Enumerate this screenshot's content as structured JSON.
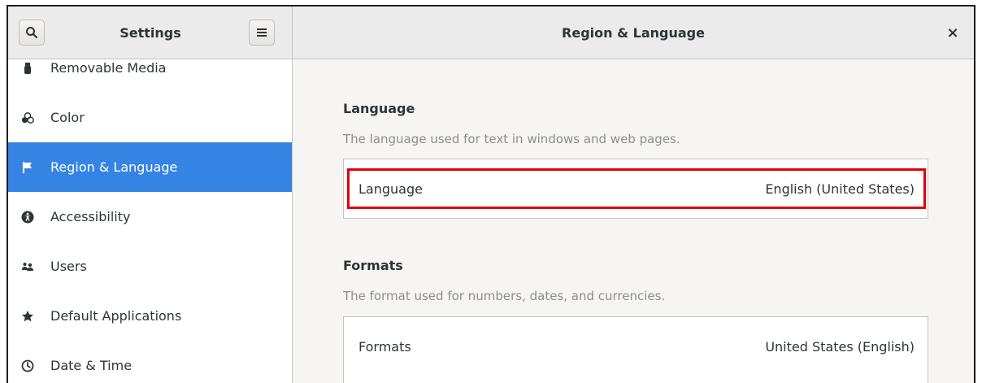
{
  "header": {
    "sidebar_title": "Settings",
    "panel_title": "Region & Language",
    "close_glyph": "×"
  },
  "sidebar": {
    "items": [
      {
        "label": "Removable Media",
        "icon": "usb-drive-icon",
        "selected": false
      },
      {
        "label": "Color",
        "icon": "color-icon",
        "selected": false
      },
      {
        "label": "Region & Language",
        "icon": "flag-icon",
        "selected": true
      },
      {
        "label": "Accessibility",
        "icon": "accessibility-icon",
        "selected": false
      },
      {
        "label": "Users",
        "icon": "users-icon",
        "selected": false
      },
      {
        "label": "Default Applications",
        "icon": "star-icon",
        "selected": false
      },
      {
        "label": "Date & Time",
        "icon": "clock-icon",
        "selected": false
      }
    ]
  },
  "language_section": {
    "title": "Language",
    "description": "The language used for text in windows and web pages.",
    "row_label": "Language",
    "row_value": "English (United States)"
  },
  "formats_section": {
    "title": "Formats",
    "description": "The format used for numbers, dates, and currencies.",
    "row_label": "Formats",
    "row_value": "United States (English)"
  },
  "colors": {
    "accent": "#3584e4",
    "highlight_border": "#e0000a"
  }
}
